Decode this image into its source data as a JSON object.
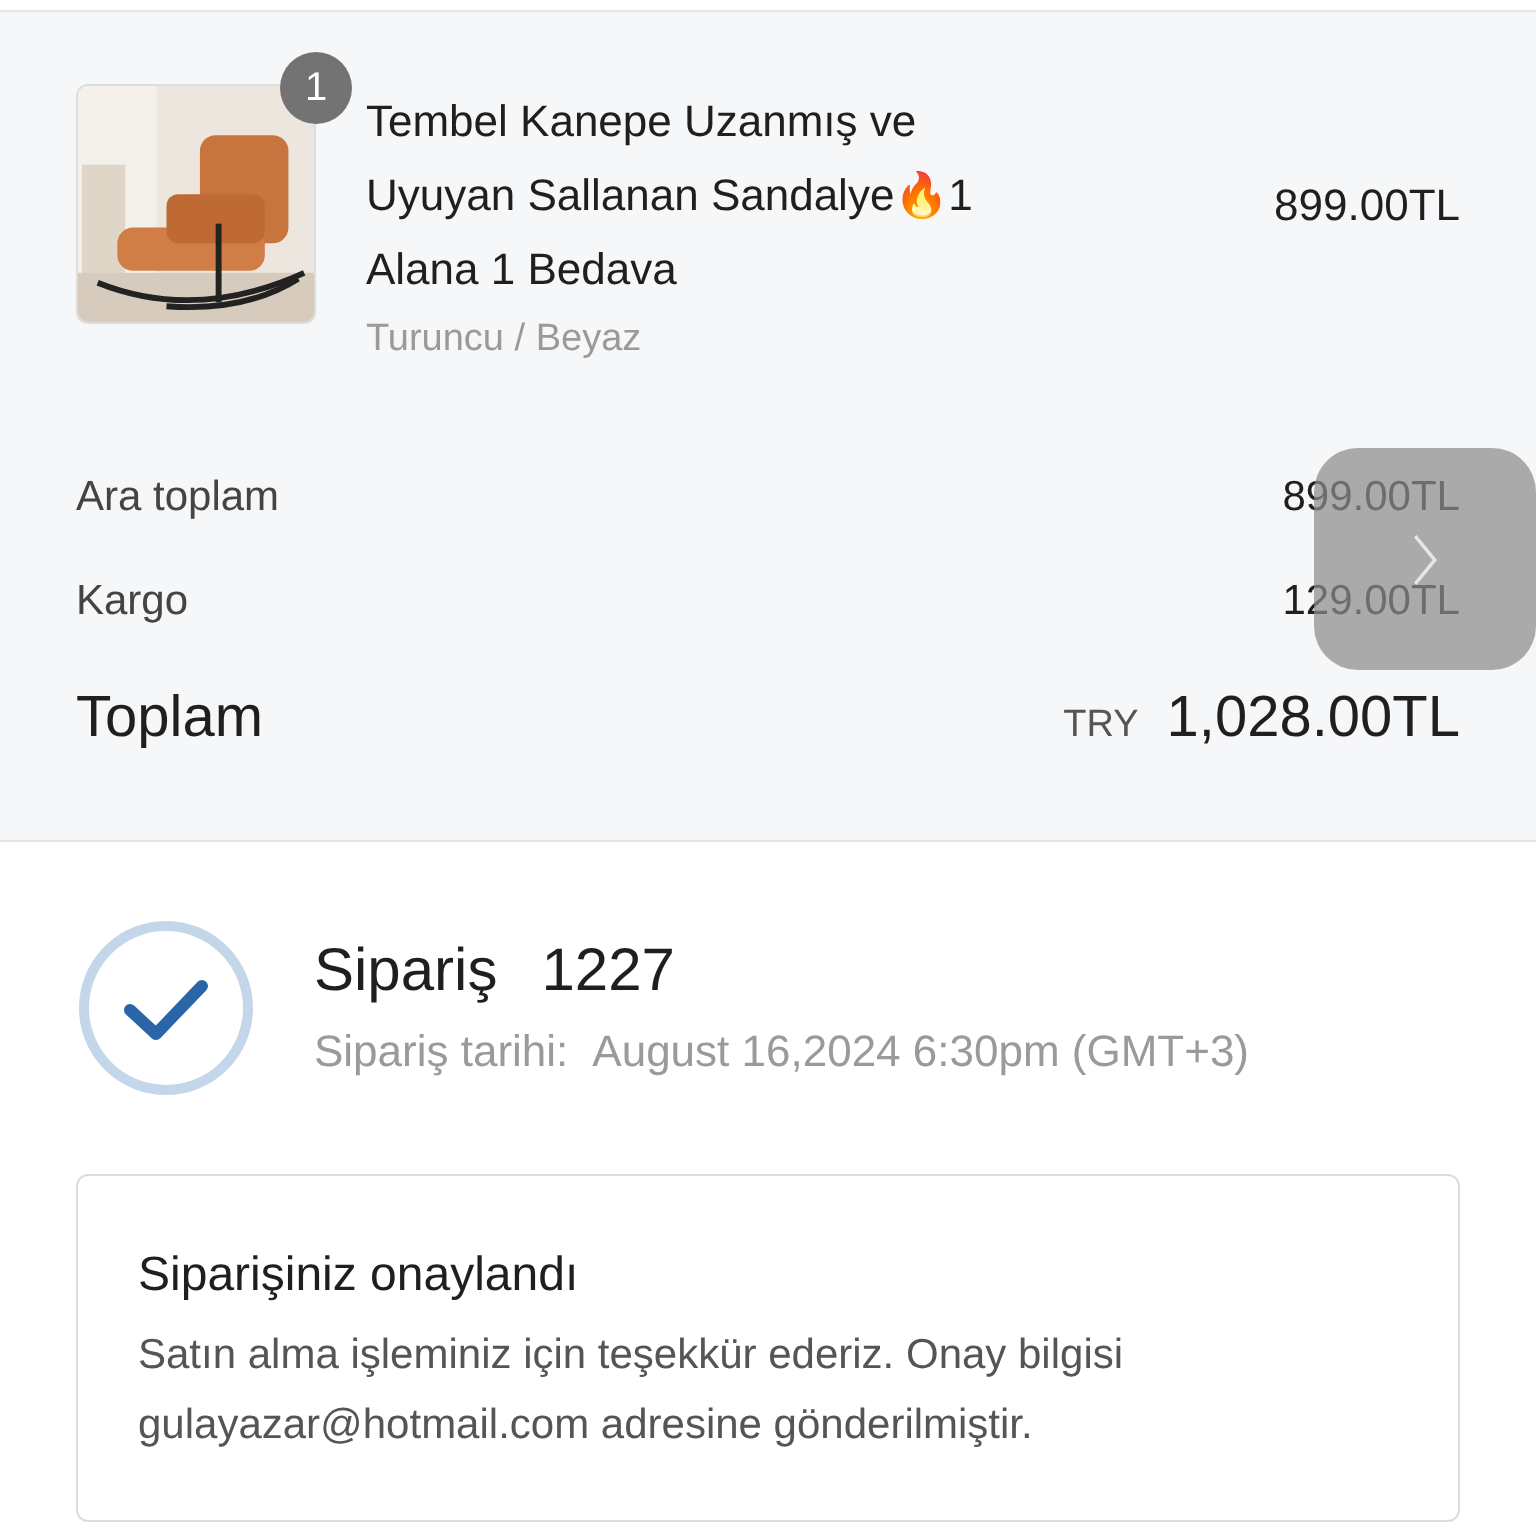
{
  "item": {
    "quantity": "1",
    "title": "Tembel Kanepe Uzanmış ve Uyuyan Sallanan Sandalye🔥1 Alana 1 Bedava",
    "variant": "Turuncu / Beyaz",
    "price": "899.00TL"
  },
  "summary": [
    {
      "label": "Ara toplam",
      "value": "899.00TL"
    },
    {
      "label": "Kargo",
      "value": "129.00TL"
    }
  ],
  "total": {
    "label": "Toplam",
    "currency": "TRY",
    "value": "1,028.00TL"
  },
  "order": {
    "title": "Sipariş",
    "number": "1227",
    "date_label": "Sipariş tarihi:",
    "date": "August 16,2024 6:30pm (GMT+3)"
  },
  "confirmation": {
    "heading": "Siparişiniz onaylandı",
    "message": "Satın alma işleminiz için teşekkür ederiz. Onay bilgisi gulayazar@hotmail.com adresine gönderilmiştir."
  }
}
